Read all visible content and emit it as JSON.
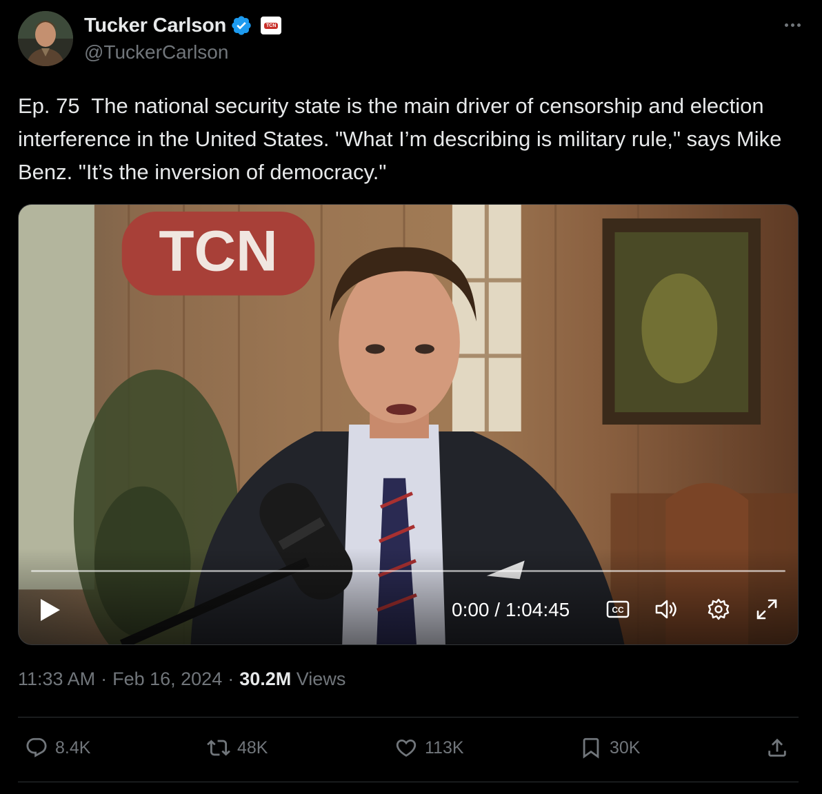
{
  "author": {
    "display_name": "Tucker Carlson",
    "handle": "@TuckerCarlson",
    "affiliate_badge": "TCN",
    "verified_color": "#1d9bf0"
  },
  "tweet": {
    "text": "Ep. 75  The national security state is the main driver of censorship and election interference in the United States. \"What I’m describing is military rule,\" says Mike Benz. \"It’s the inversion of democracy.\""
  },
  "video": {
    "logo_text": "TCN",
    "current_time": "0:00",
    "duration": "1:04:45",
    "time_display": "0:00 / 1:04:45",
    "progress": 0
  },
  "meta": {
    "time": "11:33 AM",
    "date": "Feb 16, 2024",
    "separator": "·",
    "views_count": "30.2M",
    "views_label": "Views"
  },
  "actions": {
    "replies": "8.4K",
    "reposts": "48K",
    "likes": "113K",
    "bookmarks": "30K"
  }
}
